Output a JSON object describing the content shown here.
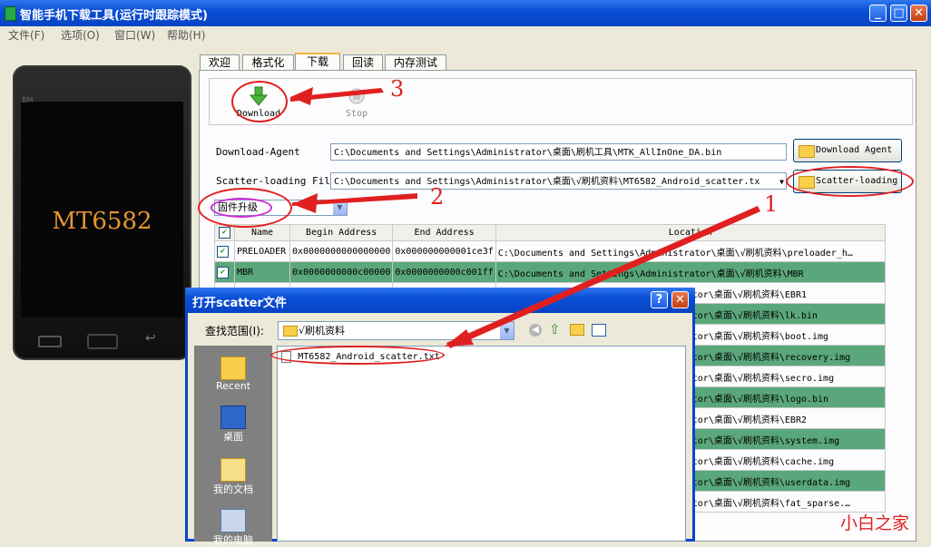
{
  "window": {
    "title": "智能手机下载工具(运行时跟踪模式)",
    "min": "_",
    "max": "□",
    "close": "✕"
  },
  "menu": [
    "文件(F)",
    "选项(O)",
    "窗口(W)",
    "帮助(H)"
  ],
  "phone": {
    "brand": "BM",
    "model": "MT6582"
  },
  "tabs": [
    "欢迎",
    "格式化",
    "下载",
    "回读",
    "内存测试"
  ],
  "active_tab": "下载",
  "toolbar": {
    "download": "Download",
    "stop": "Stop"
  },
  "download_agent": {
    "label": "Download-Agent",
    "path": "C:\\Documents and Settings\\Administrator\\桌面\\刷机工具\\MTK_AllInOne_DA.bin",
    "button": "Download Agent"
  },
  "scatter": {
    "label": "Scatter-loading File",
    "path": "C:\\Documents and Settings\\Administrator\\桌面\\√刷机资料\\MT6582_Android_scatter.tx",
    "button": "Scatter-loading"
  },
  "mode": {
    "selected": "固件升级"
  },
  "table": {
    "columns": [
      "Name",
      "Begin Address",
      "End Address",
      "Location"
    ],
    "rows": [
      {
        "name": "PRELOADER",
        "begin": "0x0000000000000000",
        "end": "0x000000000001ce3f",
        "loc": "C:\\Documents and Settings\\Administrator\\桌面\\√刷机资料\\preloader_h…"
      },
      {
        "name": "MBR",
        "begin": "0x0000000000c00000",
        "end": "0x0000000000c001ff",
        "loc": "C:\\Documents and Settings\\Administrator\\桌面\\√刷机资料\\MBR"
      }
    ],
    "partial_locations": [
      "ator\\桌面\\√刷机资料\\EBR1",
      "ator\\桌面\\√刷机资料\\lk.bin",
      "ator\\桌面\\√刷机资料\\boot.img",
      "ator\\桌面\\√刷机资料\\recovery.img",
      "ator\\桌面\\√刷机资料\\secro.img",
      "ator\\桌面\\√刷机资料\\logo.bin",
      "ator\\桌面\\√刷机资料\\EBR2",
      "ator\\桌面\\√刷机资料\\system.img",
      "ator\\桌面\\√刷机资料\\cache.img",
      "ator\\桌面\\√刷机资料\\userdata.img",
      "ator\\桌面\\√刷机资料\\fat_sparse.…"
    ]
  },
  "dialog": {
    "title": "打开scatter文件",
    "help": "?",
    "close": "✕",
    "lookin_label": "查找范围(I):",
    "lookin_value": "√刷机资料",
    "places": [
      "Recent",
      "桌面",
      "我的文档",
      "我的电脑"
    ],
    "files": [
      "MT6582_Android_scatter.txt"
    ]
  },
  "annotations": {
    "n1": "1",
    "n2": "2",
    "n3": "3"
  },
  "watermark": "小白之家"
}
